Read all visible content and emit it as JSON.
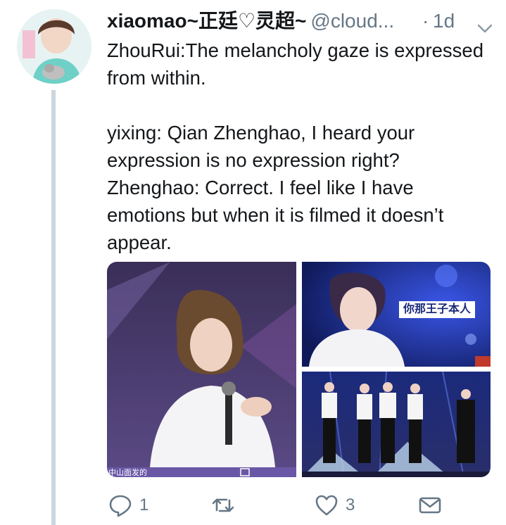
{
  "tweet": {
    "display_name": "xiaomao~正廷♡灵超~",
    "handle": "@cloud...",
    "separator": "·",
    "time": "1d",
    "paragraphs": [
      "ZhouRui:The melancholy gaze is expressed from within.",
      "yixing: Qian Zhenghao, I heard your expression is no expression right? Zhenghao: Correct. I feel like I have emotions but when it is filmed it doesn’t appear."
    ],
    "media_captions": {
      "photo1_subtitle": "中山面发的",
      "photo2_banner": "你那王子本人"
    },
    "actions": {
      "reply_count": "1",
      "retweet_count": "",
      "like_count": "3"
    }
  },
  "colors": {
    "text": "#14171a",
    "secondary": "#657786",
    "thread_line": "#ccd6dd",
    "stage_purple": "#4b3a74",
    "stage_blue": "#1c2f9a"
  }
}
